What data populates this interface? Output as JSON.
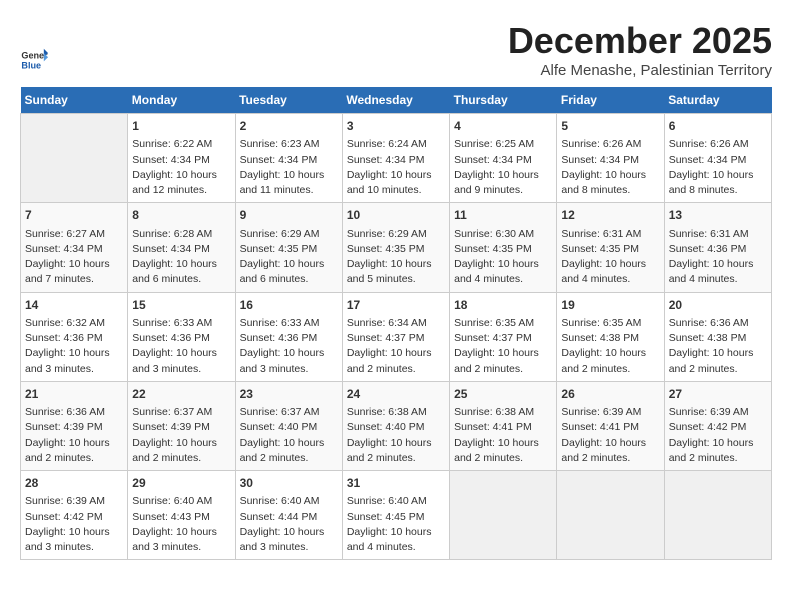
{
  "header": {
    "logo_line1": "General",
    "logo_line2": "Blue",
    "month": "December 2025",
    "location": "Alfe Menashe, Palestinian Territory"
  },
  "days_of_week": [
    "Sunday",
    "Monday",
    "Tuesday",
    "Wednesday",
    "Thursday",
    "Friday",
    "Saturday"
  ],
  "weeks": [
    [
      {
        "day": "",
        "empty": true
      },
      {
        "day": "1",
        "sunrise": "6:22 AM",
        "sunset": "4:34 PM",
        "daylight": "10 hours and 12 minutes."
      },
      {
        "day": "2",
        "sunrise": "6:23 AM",
        "sunset": "4:34 PM",
        "daylight": "10 hours and 11 minutes."
      },
      {
        "day": "3",
        "sunrise": "6:24 AM",
        "sunset": "4:34 PM",
        "daylight": "10 hours and 10 minutes."
      },
      {
        "day": "4",
        "sunrise": "6:25 AM",
        "sunset": "4:34 PM",
        "daylight": "10 hours and 9 minutes."
      },
      {
        "day": "5",
        "sunrise": "6:26 AM",
        "sunset": "4:34 PM",
        "daylight": "10 hours and 8 minutes."
      },
      {
        "day": "6",
        "sunrise": "6:26 AM",
        "sunset": "4:34 PM",
        "daylight": "10 hours and 8 minutes."
      }
    ],
    [
      {
        "day": "7",
        "sunrise": "6:27 AM",
        "sunset": "4:34 PM",
        "daylight": "10 hours and 7 minutes."
      },
      {
        "day": "8",
        "sunrise": "6:28 AM",
        "sunset": "4:34 PM",
        "daylight": "10 hours and 6 minutes."
      },
      {
        "day": "9",
        "sunrise": "6:29 AM",
        "sunset": "4:35 PM",
        "daylight": "10 hours and 6 minutes."
      },
      {
        "day": "10",
        "sunrise": "6:29 AM",
        "sunset": "4:35 PM",
        "daylight": "10 hours and 5 minutes."
      },
      {
        "day": "11",
        "sunrise": "6:30 AM",
        "sunset": "4:35 PM",
        "daylight": "10 hours and 4 minutes."
      },
      {
        "day": "12",
        "sunrise": "6:31 AM",
        "sunset": "4:35 PM",
        "daylight": "10 hours and 4 minutes."
      },
      {
        "day": "13",
        "sunrise": "6:31 AM",
        "sunset": "4:36 PM",
        "daylight": "10 hours and 4 minutes."
      }
    ],
    [
      {
        "day": "14",
        "sunrise": "6:32 AM",
        "sunset": "4:36 PM",
        "daylight": "10 hours and 3 minutes."
      },
      {
        "day": "15",
        "sunrise": "6:33 AM",
        "sunset": "4:36 PM",
        "daylight": "10 hours and 3 minutes."
      },
      {
        "day": "16",
        "sunrise": "6:33 AM",
        "sunset": "4:36 PM",
        "daylight": "10 hours and 3 minutes."
      },
      {
        "day": "17",
        "sunrise": "6:34 AM",
        "sunset": "4:37 PM",
        "daylight": "10 hours and 2 minutes."
      },
      {
        "day": "18",
        "sunrise": "6:35 AM",
        "sunset": "4:37 PM",
        "daylight": "10 hours and 2 minutes."
      },
      {
        "day": "19",
        "sunrise": "6:35 AM",
        "sunset": "4:38 PM",
        "daylight": "10 hours and 2 minutes."
      },
      {
        "day": "20",
        "sunrise": "6:36 AM",
        "sunset": "4:38 PM",
        "daylight": "10 hours and 2 minutes."
      }
    ],
    [
      {
        "day": "21",
        "sunrise": "6:36 AM",
        "sunset": "4:39 PM",
        "daylight": "10 hours and 2 minutes."
      },
      {
        "day": "22",
        "sunrise": "6:37 AM",
        "sunset": "4:39 PM",
        "daylight": "10 hours and 2 minutes."
      },
      {
        "day": "23",
        "sunrise": "6:37 AM",
        "sunset": "4:40 PM",
        "daylight": "10 hours and 2 minutes."
      },
      {
        "day": "24",
        "sunrise": "6:38 AM",
        "sunset": "4:40 PM",
        "daylight": "10 hours and 2 minutes."
      },
      {
        "day": "25",
        "sunrise": "6:38 AM",
        "sunset": "4:41 PM",
        "daylight": "10 hours and 2 minutes."
      },
      {
        "day": "26",
        "sunrise": "6:39 AM",
        "sunset": "4:41 PM",
        "daylight": "10 hours and 2 minutes."
      },
      {
        "day": "27",
        "sunrise": "6:39 AM",
        "sunset": "4:42 PM",
        "daylight": "10 hours and 2 minutes."
      }
    ],
    [
      {
        "day": "28",
        "sunrise": "6:39 AM",
        "sunset": "4:42 PM",
        "daylight": "10 hours and 3 minutes."
      },
      {
        "day": "29",
        "sunrise": "6:40 AM",
        "sunset": "4:43 PM",
        "daylight": "10 hours and 3 minutes."
      },
      {
        "day": "30",
        "sunrise": "6:40 AM",
        "sunset": "4:44 PM",
        "daylight": "10 hours and 3 minutes."
      },
      {
        "day": "31",
        "sunrise": "6:40 AM",
        "sunset": "4:45 PM",
        "daylight": "10 hours and 4 minutes."
      },
      {
        "day": "",
        "empty": true
      },
      {
        "day": "",
        "empty": true
      },
      {
        "day": "",
        "empty": true
      }
    ]
  ]
}
